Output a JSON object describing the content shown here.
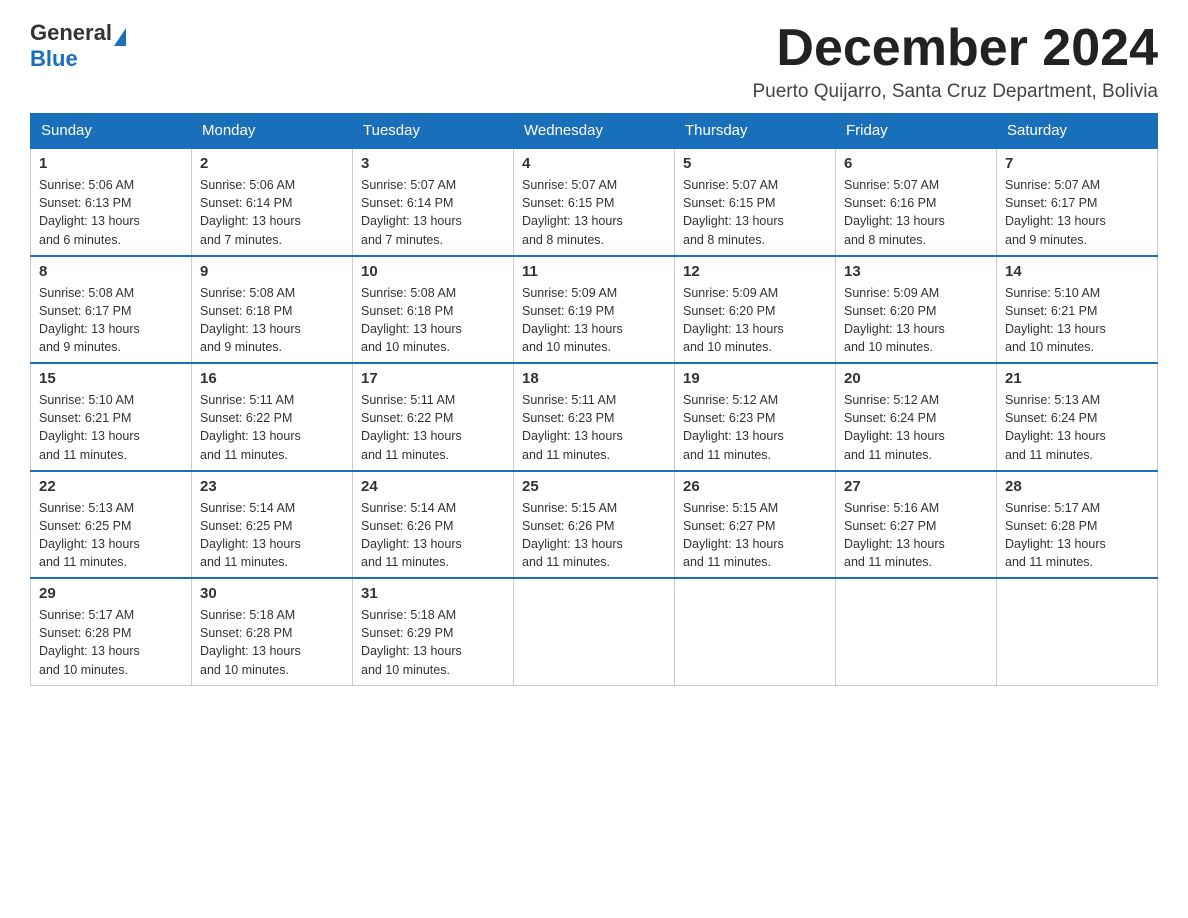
{
  "logo": {
    "general": "General",
    "blue": "Blue"
  },
  "title": "December 2024",
  "subtitle": "Puerto Quijarro, Santa Cruz Department, Bolivia",
  "days_of_week": [
    "Sunday",
    "Monday",
    "Tuesday",
    "Wednesday",
    "Thursday",
    "Friday",
    "Saturday"
  ],
  "weeks": [
    [
      {
        "day": "1",
        "sunrise": "5:06 AM",
        "sunset": "6:13 PM",
        "daylight": "13 hours and 6 minutes."
      },
      {
        "day": "2",
        "sunrise": "5:06 AM",
        "sunset": "6:14 PM",
        "daylight": "13 hours and 7 minutes."
      },
      {
        "day": "3",
        "sunrise": "5:07 AM",
        "sunset": "6:14 PM",
        "daylight": "13 hours and 7 minutes."
      },
      {
        "day": "4",
        "sunrise": "5:07 AM",
        "sunset": "6:15 PM",
        "daylight": "13 hours and 8 minutes."
      },
      {
        "day": "5",
        "sunrise": "5:07 AM",
        "sunset": "6:15 PM",
        "daylight": "13 hours and 8 minutes."
      },
      {
        "day": "6",
        "sunrise": "5:07 AM",
        "sunset": "6:16 PM",
        "daylight": "13 hours and 8 minutes."
      },
      {
        "day": "7",
        "sunrise": "5:07 AM",
        "sunset": "6:17 PM",
        "daylight": "13 hours and 9 minutes."
      }
    ],
    [
      {
        "day": "8",
        "sunrise": "5:08 AM",
        "sunset": "6:17 PM",
        "daylight": "13 hours and 9 minutes."
      },
      {
        "day": "9",
        "sunrise": "5:08 AM",
        "sunset": "6:18 PM",
        "daylight": "13 hours and 9 minutes."
      },
      {
        "day": "10",
        "sunrise": "5:08 AM",
        "sunset": "6:18 PM",
        "daylight": "13 hours and 10 minutes."
      },
      {
        "day": "11",
        "sunrise": "5:09 AM",
        "sunset": "6:19 PM",
        "daylight": "13 hours and 10 minutes."
      },
      {
        "day": "12",
        "sunrise": "5:09 AM",
        "sunset": "6:20 PM",
        "daylight": "13 hours and 10 minutes."
      },
      {
        "day": "13",
        "sunrise": "5:09 AM",
        "sunset": "6:20 PM",
        "daylight": "13 hours and 10 minutes."
      },
      {
        "day": "14",
        "sunrise": "5:10 AM",
        "sunset": "6:21 PM",
        "daylight": "13 hours and 10 minutes."
      }
    ],
    [
      {
        "day": "15",
        "sunrise": "5:10 AM",
        "sunset": "6:21 PM",
        "daylight": "13 hours and 11 minutes."
      },
      {
        "day": "16",
        "sunrise": "5:11 AM",
        "sunset": "6:22 PM",
        "daylight": "13 hours and 11 minutes."
      },
      {
        "day": "17",
        "sunrise": "5:11 AM",
        "sunset": "6:22 PM",
        "daylight": "13 hours and 11 minutes."
      },
      {
        "day": "18",
        "sunrise": "5:11 AM",
        "sunset": "6:23 PM",
        "daylight": "13 hours and 11 minutes."
      },
      {
        "day": "19",
        "sunrise": "5:12 AM",
        "sunset": "6:23 PM",
        "daylight": "13 hours and 11 minutes."
      },
      {
        "day": "20",
        "sunrise": "5:12 AM",
        "sunset": "6:24 PM",
        "daylight": "13 hours and 11 minutes."
      },
      {
        "day": "21",
        "sunrise": "5:13 AM",
        "sunset": "6:24 PM",
        "daylight": "13 hours and 11 minutes."
      }
    ],
    [
      {
        "day": "22",
        "sunrise": "5:13 AM",
        "sunset": "6:25 PM",
        "daylight": "13 hours and 11 minutes."
      },
      {
        "day": "23",
        "sunrise": "5:14 AM",
        "sunset": "6:25 PM",
        "daylight": "13 hours and 11 minutes."
      },
      {
        "day": "24",
        "sunrise": "5:14 AM",
        "sunset": "6:26 PM",
        "daylight": "13 hours and 11 minutes."
      },
      {
        "day": "25",
        "sunrise": "5:15 AM",
        "sunset": "6:26 PM",
        "daylight": "13 hours and 11 minutes."
      },
      {
        "day": "26",
        "sunrise": "5:15 AM",
        "sunset": "6:27 PM",
        "daylight": "13 hours and 11 minutes."
      },
      {
        "day": "27",
        "sunrise": "5:16 AM",
        "sunset": "6:27 PM",
        "daylight": "13 hours and 11 minutes."
      },
      {
        "day": "28",
        "sunrise": "5:17 AM",
        "sunset": "6:28 PM",
        "daylight": "13 hours and 11 minutes."
      }
    ],
    [
      {
        "day": "29",
        "sunrise": "5:17 AM",
        "sunset": "6:28 PM",
        "daylight": "13 hours and 10 minutes."
      },
      {
        "day": "30",
        "sunrise": "5:18 AM",
        "sunset": "6:28 PM",
        "daylight": "13 hours and 10 minutes."
      },
      {
        "day": "31",
        "sunrise": "5:18 AM",
        "sunset": "6:29 PM",
        "daylight": "13 hours and 10 minutes."
      },
      null,
      null,
      null,
      null
    ]
  ],
  "labels": {
    "sunrise": "Sunrise:",
    "sunset": "Sunset:",
    "daylight": "Daylight:"
  }
}
